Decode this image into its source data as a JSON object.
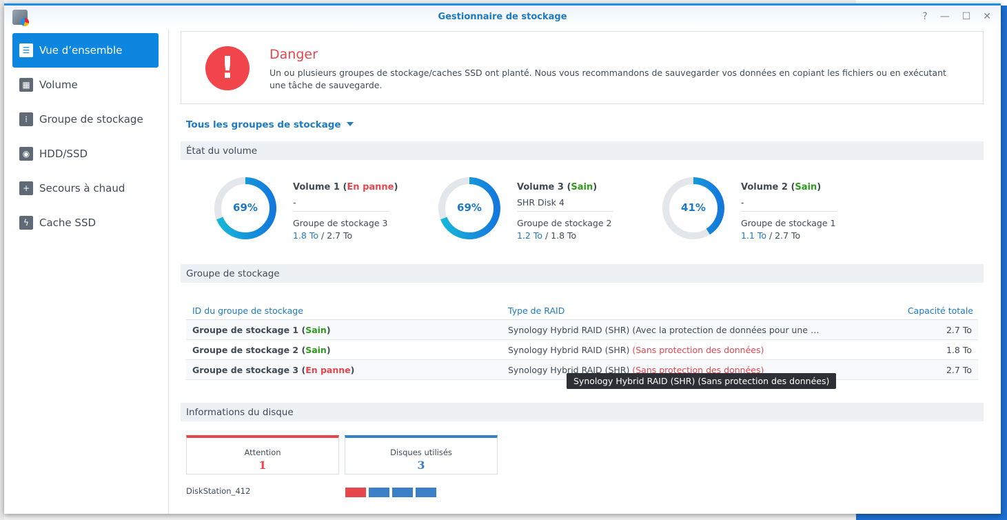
{
  "window": {
    "title": "Gestionnaire de stockage",
    "buttons": [
      "?",
      "—",
      "☐",
      "✕"
    ]
  },
  "sidebar": {
    "items": [
      {
        "label": "Vue d’ensemble",
        "icon": "overview-icon",
        "glyph": "☰",
        "active": true
      },
      {
        "label": "Volume",
        "icon": "cubes-icon",
        "glyph": "▦"
      },
      {
        "label": "Groupe de stockage",
        "icon": "storage-pool-icon",
        "glyph": "⁞"
      },
      {
        "label": "HDD/SSD",
        "icon": "disk-icon",
        "glyph": "◉"
      },
      {
        "label": "Secours à chaud",
        "icon": "hot-spare-icon",
        "glyph": "+"
      },
      {
        "label": "Cache SSD",
        "icon": "ssd-cache-icon",
        "glyph": "ϟ"
      }
    ]
  },
  "alert": {
    "icon": "!",
    "title": "Danger",
    "message": "Un ou plusieurs groupes de stockage/caches SSD ont planté. Nous vous recommandons de sauvegarder vos données en copiant les fichiers ou en exécutant une tâche de sauvegarde."
  },
  "filter": {
    "label": "Tous les groupes de stockage"
  },
  "volume_section": {
    "title": "État du volume",
    "volumes": [
      {
        "name": "Volume 1",
        "status": "En panne",
        "status_color": "#e8464d",
        "percent": 69,
        "percent_label": "69%",
        "desc": "-",
        "pool": "Groupe de stockage 3",
        "used": "1.8 To",
        "total": " / 2.7 To"
      },
      {
        "name": "Volume 3",
        "status": "Sain",
        "status_color": "#2d9c1c",
        "percent": 69,
        "percent_label": "69%",
        "desc": "SHR Disk 4",
        "pool": "Groupe de stockage 2",
        "used": "1.2 To",
        "total": " / 1.8 To"
      },
      {
        "name": "Volume 2",
        "status": "Sain",
        "status_color": "#2d9c1c",
        "percent": 41,
        "percent_label": "41%",
        "desc": "-",
        "pool": "Groupe de stockage 1",
        "used": "1.1 To",
        "total": " / 2.7 To"
      }
    ]
  },
  "pool_section": {
    "title": "Groupe de stockage",
    "columns": [
      "ID du groupe de stockage",
      "Type de RAID",
      "Capacité totale"
    ],
    "rows": [
      {
        "name": "Groupe de stockage 1",
        "status": "Sain",
        "status_color": "#2d9c1c",
        "raid": "Synology Hybrid RAID (SHR)",
        "raid_note": "(Avec la protection de données pour une …",
        "note_color": "#414b55",
        "capacity": "2.7 To"
      },
      {
        "name": "Groupe de stockage 2",
        "status": "Sain",
        "status_color": "#2d9c1c",
        "raid": "Synology Hybrid RAID (SHR)",
        "raid_note": "(Sans protection des données)",
        "note_color": "#e8464d",
        "capacity": "1.8 To"
      },
      {
        "name": "Groupe de stockage 3",
        "status": "En panne",
        "status_color": "#e8464d",
        "raid": "Synology Hybrid RAID (SHR)",
        "raid_note": "(Sans protection des données)",
        "note_color": "#e8464d",
        "capacity": "2.7 To"
      }
    ],
    "tooltip": "Synology Hybrid RAID (SHR) (Sans protection des données)"
  },
  "disk_section": {
    "title": "Informations du disque",
    "cards": [
      {
        "label": "Attention",
        "value": "1",
        "color": "#e8464d"
      },
      {
        "label": "Disques utilisés",
        "value": "3",
        "color": "#3a7fc8"
      }
    ],
    "station": "DiskStation_412",
    "disks": [
      "#e8464d",
      "#3a7fc8",
      "#3a7fc8",
      "#3a7fc8"
    ]
  }
}
